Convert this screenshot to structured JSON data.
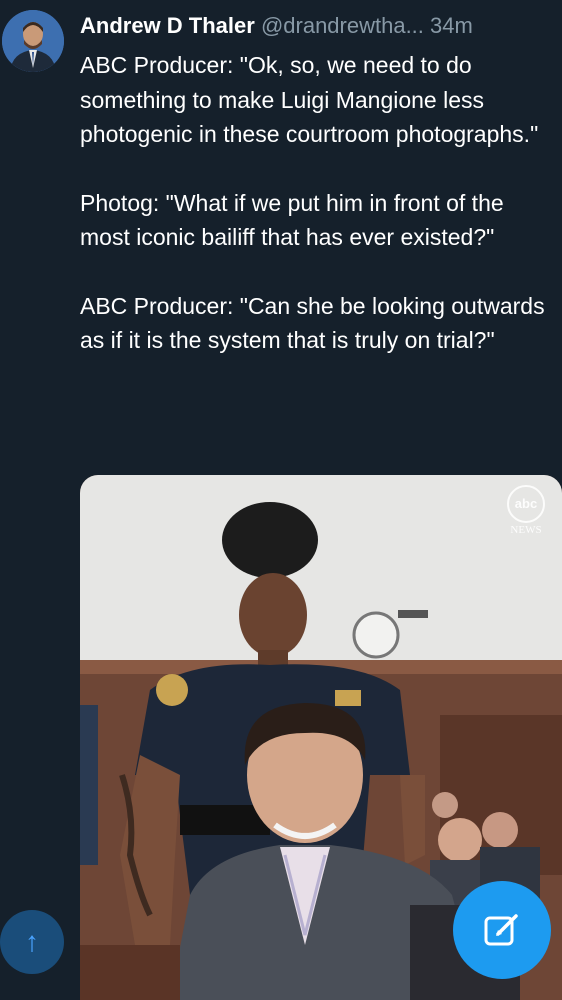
{
  "tweet": {
    "author_name": "Andrew D Thaler",
    "handle": "@drandrewtha...",
    "time": "34m",
    "paragraphs": [
      "ABC Producer: \"Ok, so, we need to do something to make Luigi Mangione less photogenic in these courtroom photographs.\"",
      "Photog: \"What if we put him in front of the most iconic bailiff that has ever existed?\"",
      "ABC Producer: \"Can she be looking outwards as if it is the system that is truly on trial?\""
    ]
  },
  "media": {
    "watermark_top": "abc",
    "watermark_bottom": "NEWS"
  },
  "controls": {
    "scroll_up_icon": "arrow-up-icon",
    "scroll_up_glyph": "↑",
    "compose_icon": "compose-icon"
  },
  "colors": {
    "background": "#15202b",
    "accent": "#1d9bf0",
    "secondary_text": "#8899a6"
  }
}
